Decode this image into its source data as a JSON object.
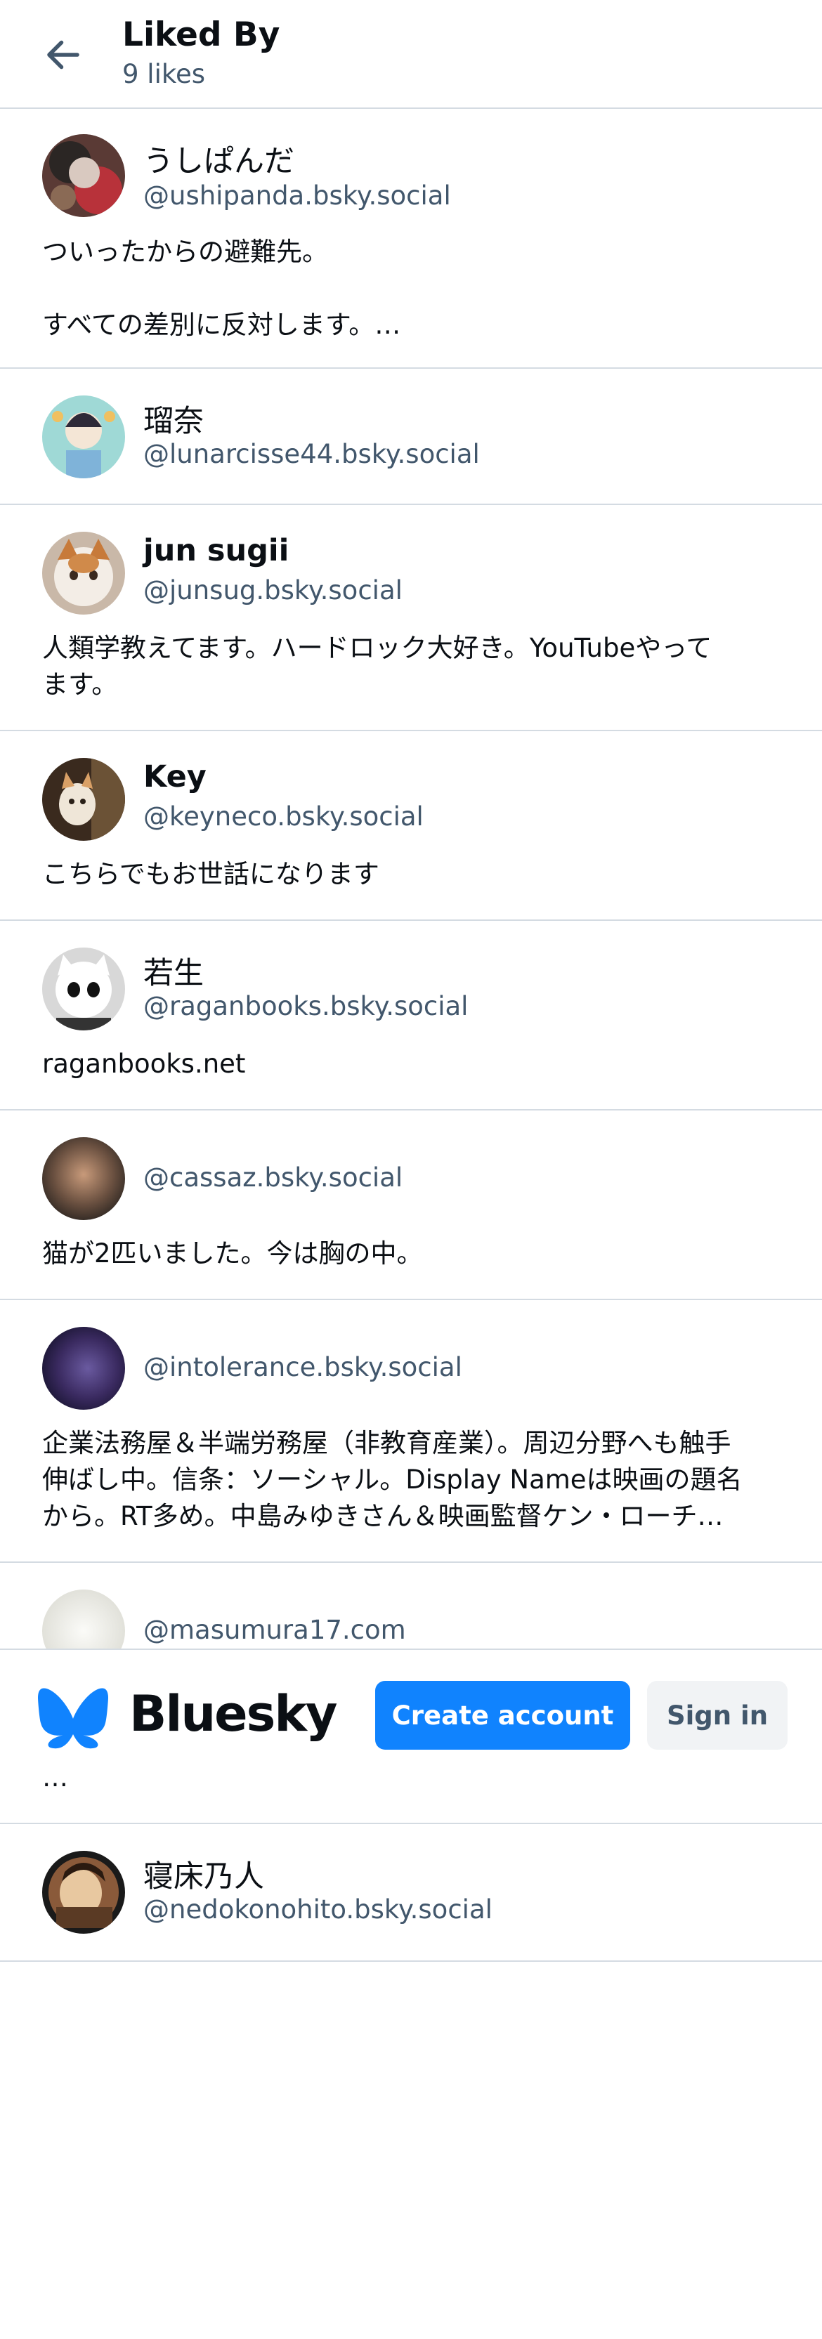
{
  "header": {
    "title": "Liked By",
    "subtitle": "9 likes",
    "back_icon": "arrow-left-icon"
  },
  "users": [
    {
      "name": "うしぱんだ",
      "handle": "@ushipanda.bsky.social",
      "bio": "ついったからの避難先。\n\nすべての差別に反対します。…"
    },
    {
      "name": "瑠奈",
      "handle": "@lunarcisse44.bsky.social",
      "bio": ""
    },
    {
      "name": "jun sugii",
      "handle": "@junsug.bsky.social",
      "bio": "人類学教えてます。ハードロック大好き。YouTubeやって\nます。"
    },
    {
      "name": "Key",
      "handle": "@keyneco.bsky.social",
      "bio": "こちらでもお世話になります"
    },
    {
      "name": "若生",
      "handle": "@raganbooks.bsky.social",
      "bio": "raganbooks.net"
    },
    {
      "name": "",
      "handle": "@cassaz.bsky.social",
      "bio": "猫が2匹いました。今は胸の中。"
    },
    {
      "name": "",
      "handle": "@intolerance.bsky.social",
      "bio": "企業法務屋＆半端労務屋（非教育産業）。周辺分野へも触手\n伸ばし中。信条：ソーシャル。Display Nameは映画の題名\nから。RT多め。中島みゆきさん＆映画監督ケン・ローチ…"
    },
    {
      "name": "",
      "handle": "@masumura17.com",
      "bio": "…"
    },
    {
      "name": "寝床乃人",
      "handle": "@nedokonohito.bsky.social",
      "bio": ""
    }
  ],
  "banner": {
    "brand": "Bluesky",
    "create_label": "Create account",
    "signin_label": "Sign in",
    "brand_color": "#1083fe"
  }
}
